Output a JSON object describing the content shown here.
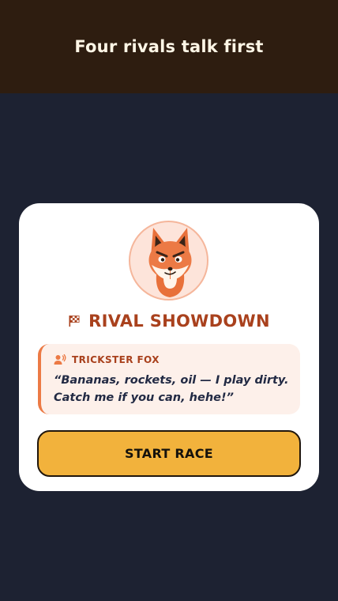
{
  "header": {
    "title": "Four rivals talk first"
  },
  "card": {
    "avatar_icon": "fox-icon",
    "title_icon": "checkered-flag-icon",
    "title": "RIVAL SHOWDOWN",
    "speech": {
      "speaker_icon": "speaking-person-icon",
      "speaker": "TRICKSTER FOX",
      "quote_line1": "“Bananas, rockets, oil — I play dirty.",
      "quote_line2": "Catch me if you can, hehe!”"
    },
    "start_button_label": "START RACE"
  },
  "colors": {
    "background": "#1d2232",
    "header_bg": "#2e1d10",
    "accent": "#a9411d",
    "fox_orange": "#ec7a45",
    "button": "#f2b23c"
  }
}
